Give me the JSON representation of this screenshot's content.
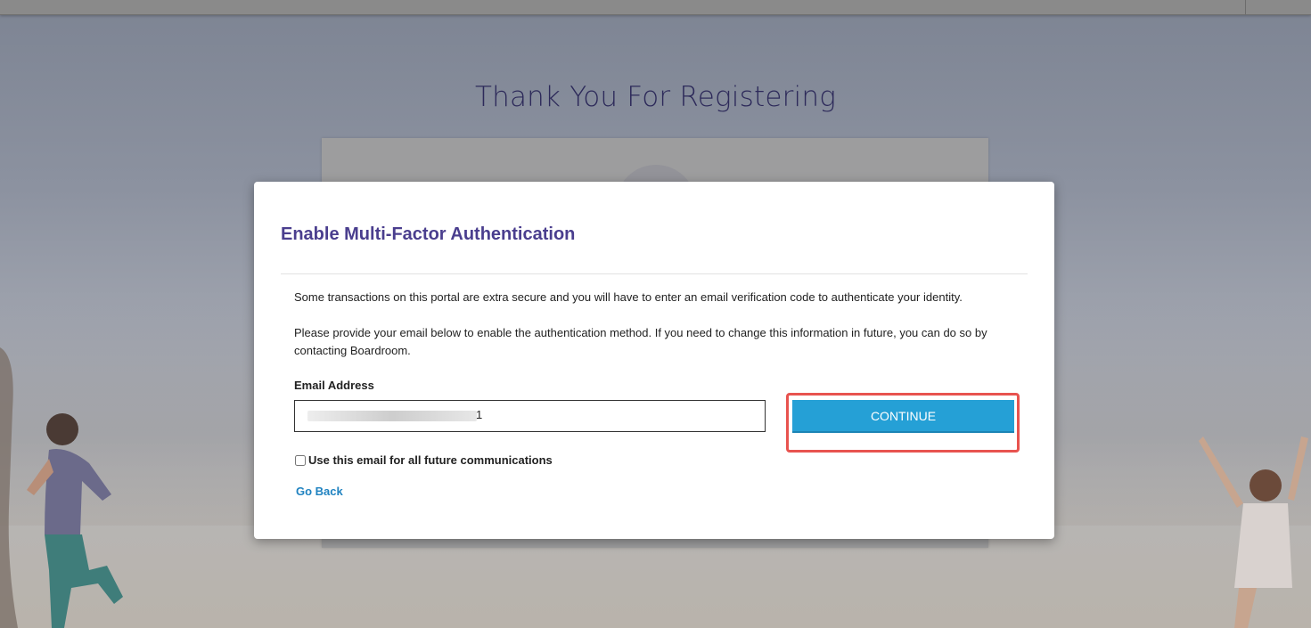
{
  "background": {
    "page_title": "Thank You For Registering"
  },
  "modal": {
    "title": "Enable Multi-Factor Authentication",
    "paragraph1": "Some transactions on this portal are extra secure and you will have to enter an email verification code to authenticate your identity.",
    "paragraph2": "Please provide your email below to enable the authentication method. If you need to change this information in future, you can do so by contacting Boardroom.",
    "email_label": "Email Address",
    "email_value_visible_tail": "1",
    "continue_label": "CONTINUE",
    "checkbox_label": "Use this email for all future communications",
    "checkbox_checked": false,
    "go_back_label": "Go Back"
  },
  "colors": {
    "title": "#4a3e8e",
    "button": "#25a0d6",
    "link": "#1f82c0",
    "highlight": "#e8534f"
  }
}
